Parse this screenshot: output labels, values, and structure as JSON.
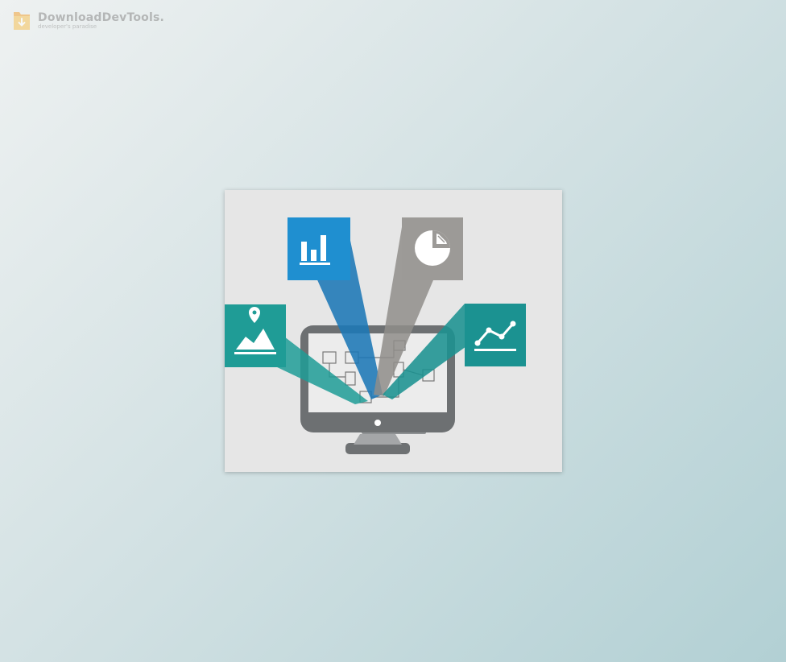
{
  "watermark": {
    "title": "DownloadDevTools.",
    "subtitle": "developer's paradise",
    "icon": "download-logo-icon"
  },
  "illustration": {
    "icons": [
      "bar-chart-icon",
      "pie-chart-icon",
      "map-location-icon",
      "line-chart-icon",
      "computer-monitor-icon",
      "network-diagram-icon"
    ],
    "colors": {
      "blue": "#1f8fd0",
      "gray": "#9c9a97",
      "teal_left": "#1f9c96",
      "teal_right": "#1b9291",
      "background": "#e6e6e6",
      "monitor": "#6d7072"
    }
  }
}
